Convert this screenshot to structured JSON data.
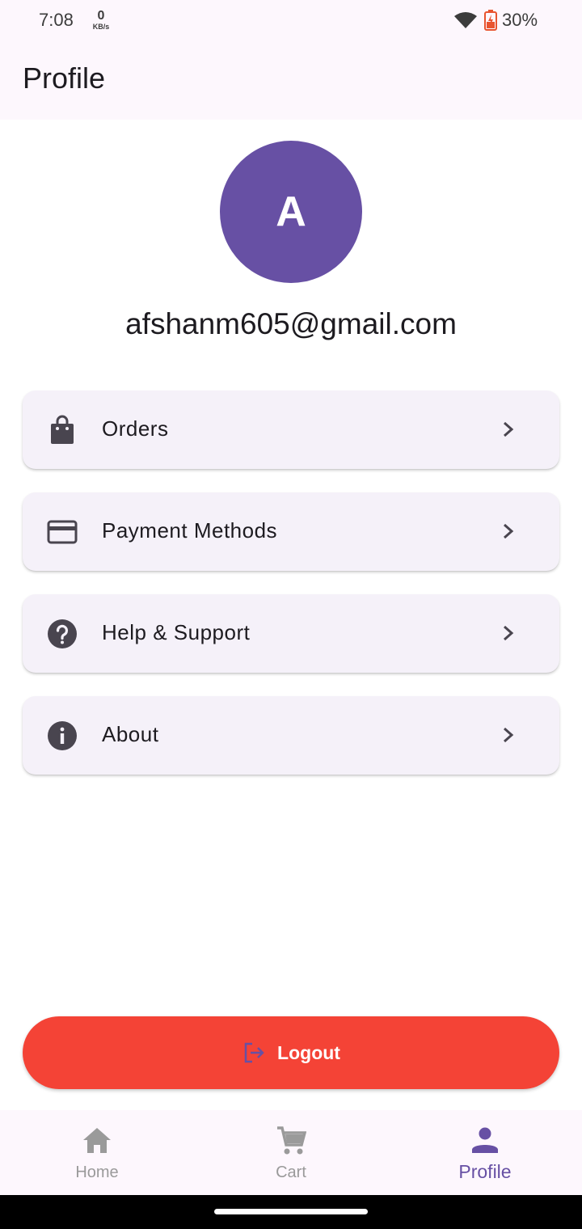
{
  "status_bar": {
    "time": "7:08",
    "net_speed_value": "0",
    "net_speed_unit": "KB/s",
    "battery_percent": "30%",
    "icons": [
      "wifi-icon",
      "battery-charging-icon"
    ]
  },
  "header": {
    "title": "Profile"
  },
  "profile": {
    "avatar_initial": "A",
    "email": "afshanm605@gmail.com",
    "avatar_color": "#6750a4"
  },
  "menu": {
    "items": [
      {
        "label": "Orders",
        "icon": "shopping-bag-icon"
      },
      {
        "label": "Payment Methods",
        "icon": "credit-card-icon"
      },
      {
        "label": "Help & Support",
        "icon": "help-icon"
      },
      {
        "label": "About",
        "icon": "info-icon"
      }
    ]
  },
  "logout": {
    "label": "Logout",
    "icon": "logout-icon",
    "color": "#f44336"
  },
  "bottom_nav": {
    "items": [
      {
        "label": "Home",
        "icon": "home-icon",
        "active": false
      },
      {
        "label": "Cart",
        "icon": "cart-icon",
        "active": false
      },
      {
        "label": "Profile",
        "icon": "person-icon",
        "active": true
      }
    ],
    "active_color": "#6750a4",
    "inactive_color": "#9a9a9a"
  }
}
